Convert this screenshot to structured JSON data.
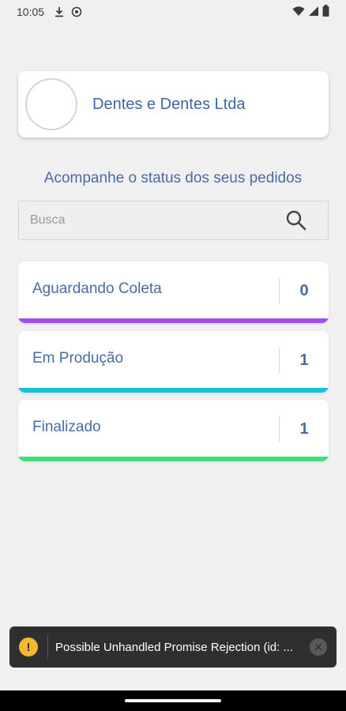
{
  "status_bar": {
    "time": "10:05"
  },
  "company": {
    "name": "Dentes e Dentes Ltda"
  },
  "subtitle": "Acompanhe o status dos seus pedidos",
  "search": {
    "placeholder": "Busca",
    "value": ""
  },
  "statuses": [
    {
      "label": "Aguardando Coleta",
      "count": "0",
      "color": "#a64df0"
    },
    {
      "label": "Em Produção",
      "count": "1",
      "color": "#16c0dc"
    },
    {
      "label": "Finalizado",
      "count": "1",
      "color": "#45dc7c"
    }
  ],
  "toast": {
    "message": "Possible Unhandled Promise Rejection (id: ...",
    "icon": "!",
    "close": "✕"
  }
}
